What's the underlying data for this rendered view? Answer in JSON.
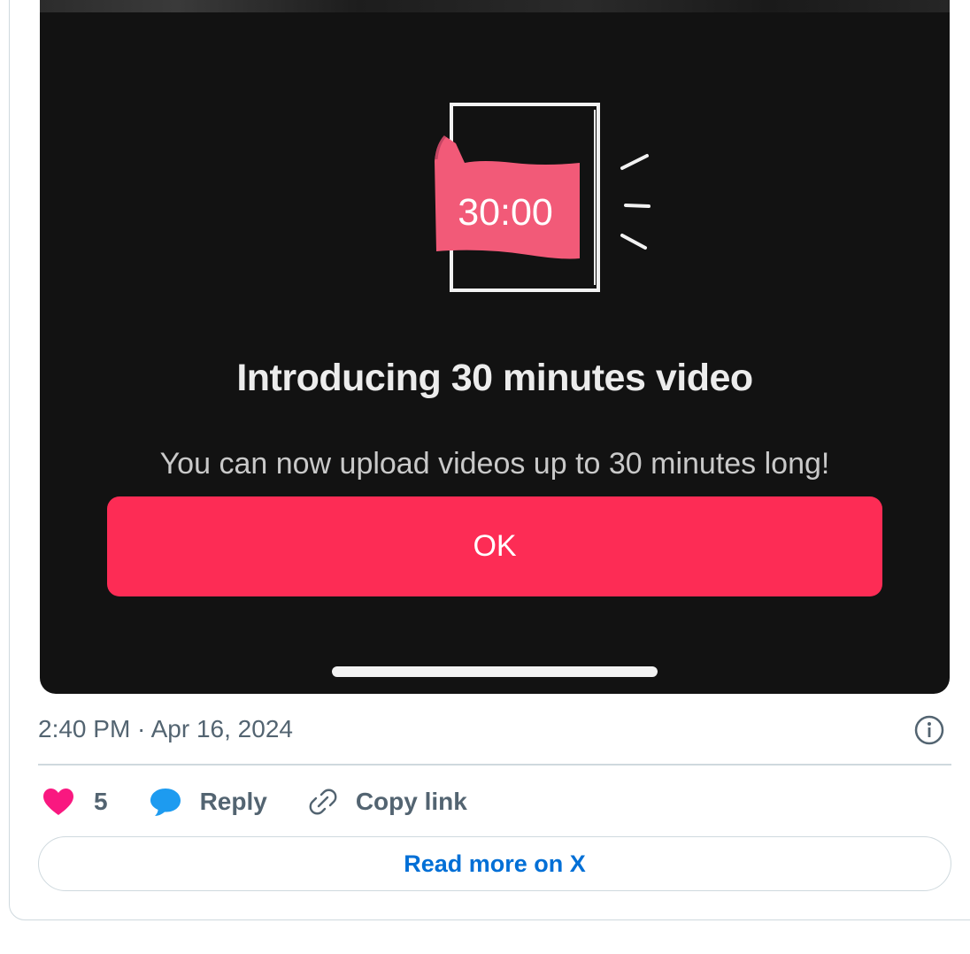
{
  "media": {
    "timer_text": "30:00",
    "headline": "Introducing 30 minutes video",
    "subtext": "You can now upload videos up to 30 minutes long!",
    "ok_label": "OK"
  },
  "tweet": {
    "timestamp": "2:40 PM · Apr 16, 2024",
    "like_count": "5",
    "reply_label": "Reply",
    "copy_link_label": "Copy link",
    "read_more_label": "Read more on X"
  },
  "icons": {
    "like": "heart-icon",
    "reply": "speech-bubble-icon",
    "copy_link": "link-icon",
    "info": "info-icon"
  },
  "colors": {
    "accent_red": "#fd2c55",
    "sticker_pink": "#f25a78",
    "like_pink": "#f91880",
    "reply_blue": "#1d9bf0",
    "link_blue": "#006fd6",
    "media_background": "#121212"
  }
}
